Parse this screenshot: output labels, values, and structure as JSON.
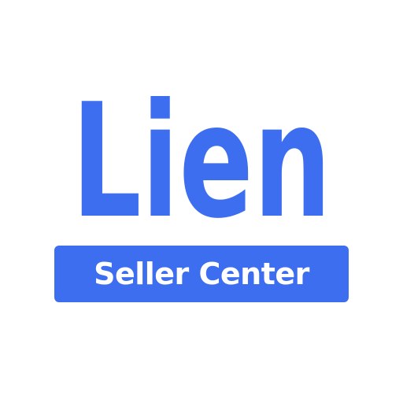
{
  "logo": {
    "wordmark": "Lien",
    "badge_label": "Seller Center"
  },
  "colors": {
    "brand": "#3d6ef0",
    "badge_text": "#ffffff",
    "background": "#ffffff"
  }
}
